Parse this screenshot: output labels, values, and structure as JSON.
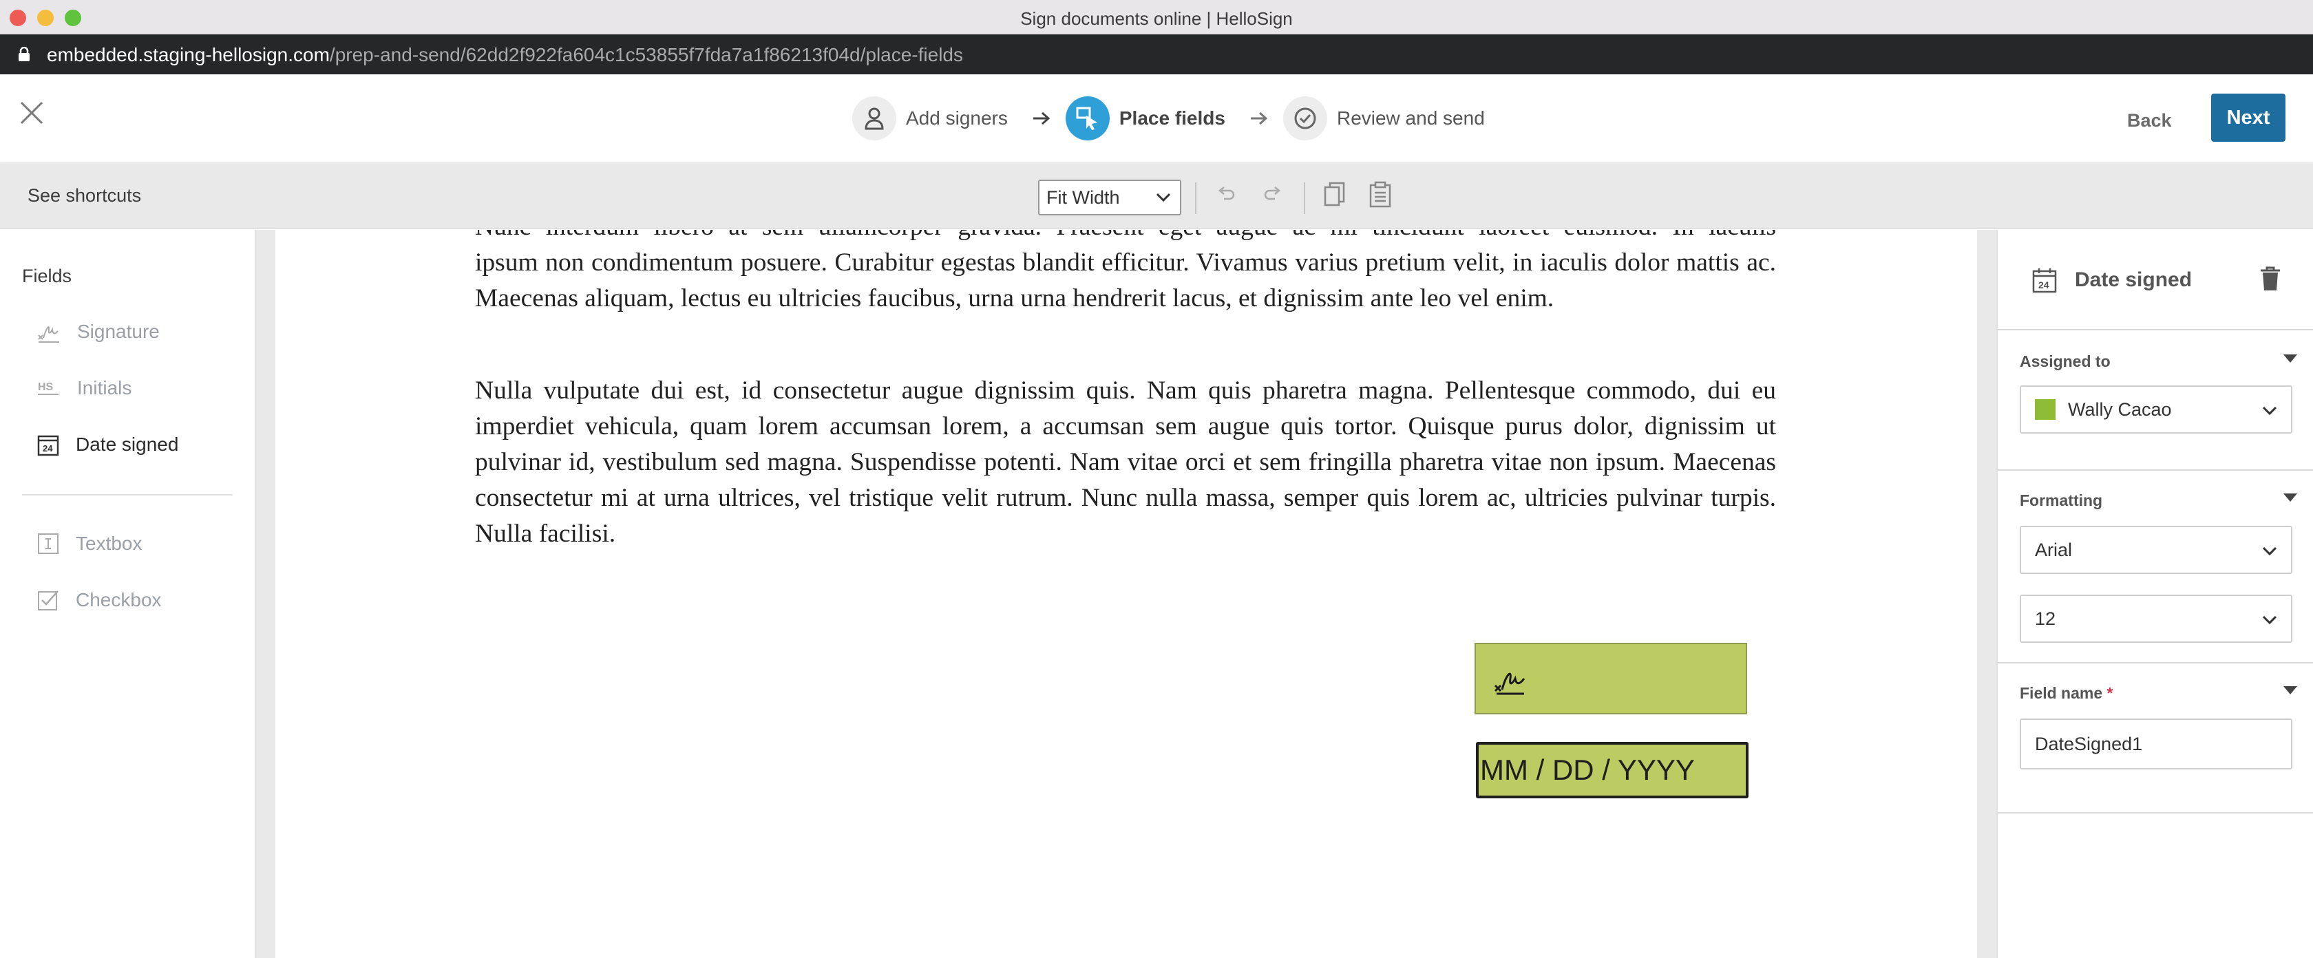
{
  "window": {
    "title": "Sign documents online | HelloSign"
  },
  "address_bar": {
    "host": "embedded.staging-hellosign.com",
    "path": "/prep-and-send/62dd2f922fa604c1c53855f7fda7a1f86213f04d/place-fields"
  },
  "header": {
    "steps": [
      {
        "label": "Add signers",
        "icon": "person-icon",
        "active": false
      },
      {
        "label": "Place fields",
        "icon": "place-fields-icon",
        "active": true
      },
      {
        "label": "Review and send",
        "icon": "check-circle-icon",
        "active": false
      }
    ],
    "back_label": "Back",
    "next_label": "Next"
  },
  "toolbar": {
    "shortcuts_label": "See shortcuts",
    "zoom_value": "Fit Width"
  },
  "fields_panel": {
    "title": "Fields",
    "items": [
      {
        "label": "Signature",
        "icon": "signature-icon",
        "active": false
      },
      {
        "label": "Initials",
        "icon": "initials-icon",
        "active": false
      },
      {
        "label": "Date signed",
        "icon": "calendar-icon",
        "active": true
      },
      {
        "label": "Textbox",
        "icon": "textbox-icon",
        "active": false
      },
      {
        "label": "Checkbox",
        "icon": "checkbox-icon",
        "active": false
      }
    ]
  },
  "document": {
    "paragraph_top_partial": "Nunc interdum libero at sem ullamcorper gravida. Praesent eget augue ac mi tincidunt laoreet euismod. In iaculis",
    "paragraph1_rest": "ipsum non condimentum posuere. Curabitur egestas blandit efficitur. Vivamus varius pretium velit, in iaculis dolor mattis ac. Maecenas aliquam, lectus eu ultricies faucibus, urna urna hendrerit lacus, et dignissim ante leo vel enim.",
    "paragraph2": "Nulla vulputate dui est, id consectetur augue dignissim quis. Nam quis pharetra magna. Pellentesque commodo, dui eu imperdiet vehicula, quam lorem accumsan lorem, a accumsan sem augue quis tortor. Quisque purus dolor, dignissim ut pulvinar id, vestibulum sed magna. Suspendisse potenti. Nam vitae orci et sem fringilla pharetra vitae non ipsum. Maecenas consectetur mi at urna ultrices, vel tristique velit rutrum. Nunc nulla massa, semper quis lorem ac, ultricies pulvinar turpis. Nulla facilisi.",
    "date_field_placeholder": "MM / DD / YYYY",
    "field_color": "#bccb62"
  },
  "properties": {
    "title": "Date signed",
    "assigned_to": {
      "label": "Assigned to",
      "value": "Wally Cacao",
      "color": "#8fbc36"
    },
    "formatting": {
      "label": "Formatting",
      "font": "Arial",
      "size": "12"
    },
    "field_name": {
      "label": "Field name",
      "required_mark": "*",
      "value": "DateSigned1"
    }
  },
  "colors": {
    "accent": "#2f9fd8",
    "next_button": "#1d6e9e"
  }
}
